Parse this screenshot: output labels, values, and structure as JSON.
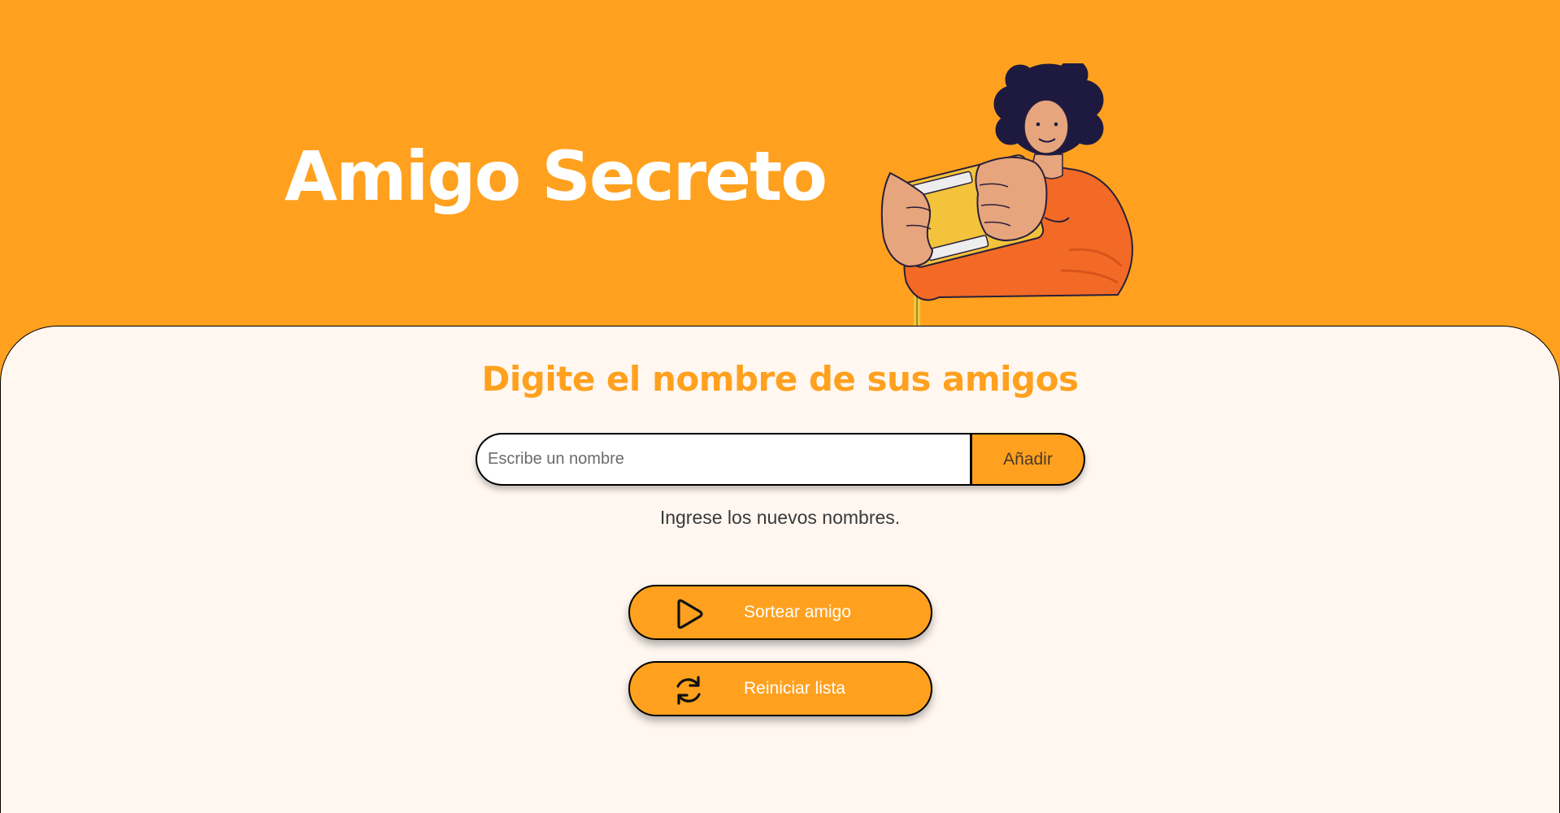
{
  "header": {
    "title": "Amigo Secreto",
    "illustration_icon": "person-with-gamepad-illustration"
  },
  "main": {
    "subtitle": "Digite el nombre de sus amigos",
    "name_input": {
      "value": "",
      "placeholder": "Escribe un nombre"
    },
    "add_button_label": "Añadir",
    "hint": "Ingrese los nuevos nombres.",
    "draw_button": {
      "label": "Sortear amigo",
      "icon": "play-icon"
    },
    "reset_button": {
      "label": "Reiniciar lista",
      "icon": "refresh-icon"
    }
  },
  "colors": {
    "accent": "#FFA11F",
    "content_background": "#FFF7F0",
    "title_text": "#FFFFFF"
  }
}
